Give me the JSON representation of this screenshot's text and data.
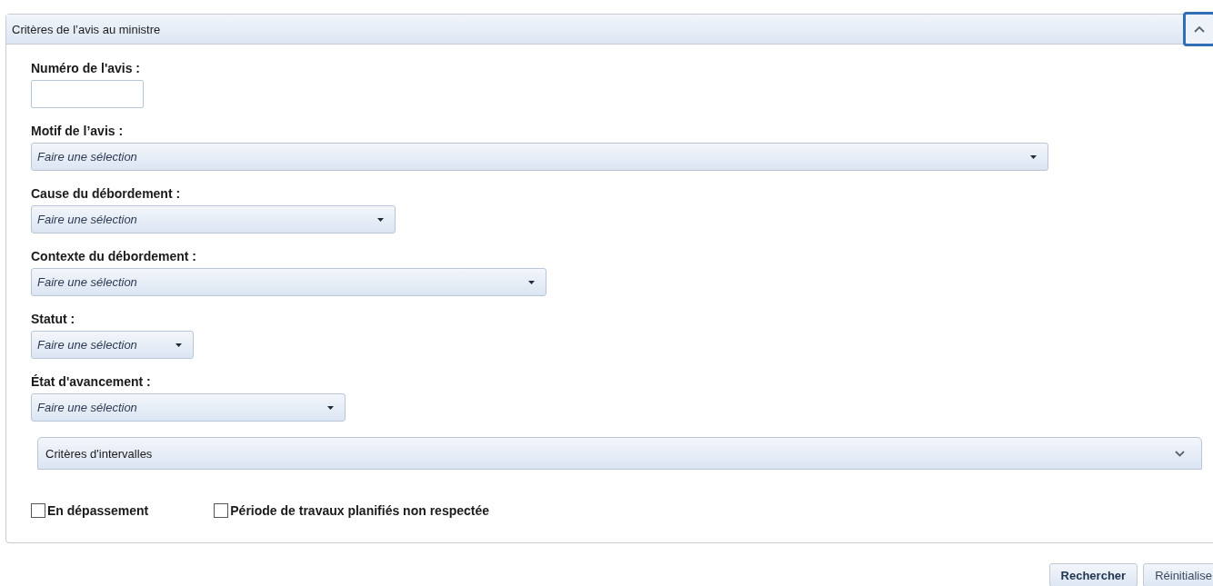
{
  "panel": {
    "title": "Critères de l’avis au ministre",
    "expanded": true
  },
  "fields": [
    {
      "kind": "text",
      "label": "Numéro de l'avis :"
    },
    {
      "kind": "select",
      "label": "Motif de l’avis :",
      "placeholder": "Faire une sélection"
    },
    {
      "kind": "select",
      "label": "Cause du débordement :",
      "placeholder": "Faire une sélection"
    },
    {
      "kind": "select",
      "label": "Contexte du débordement :",
      "placeholder": "Faire une sélection"
    },
    {
      "kind": "select",
      "label": "Statut :",
      "placeholder": "Faire une sélection"
    },
    {
      "kind": "select",
      "label": "État d'avancement :",
      "placeholder": "Faire une sélection"
    }
  ],
  "subpanel": {
    "title": "Critères d'intervalles",
    "expanded": false
  },
  "checkboxes": [
    {
      "label": "En dépassement",
      "checked": false
    },
    {
      "label": "Période de travaux planifiés non respectée",
      "checked": false
    }
  ],
  "buttons": [
    {
      "label": "Rechercher",
      "primary": true
    },
    {
      "label": "Réinitialise",
      "primary": false
    }
  ]
}
